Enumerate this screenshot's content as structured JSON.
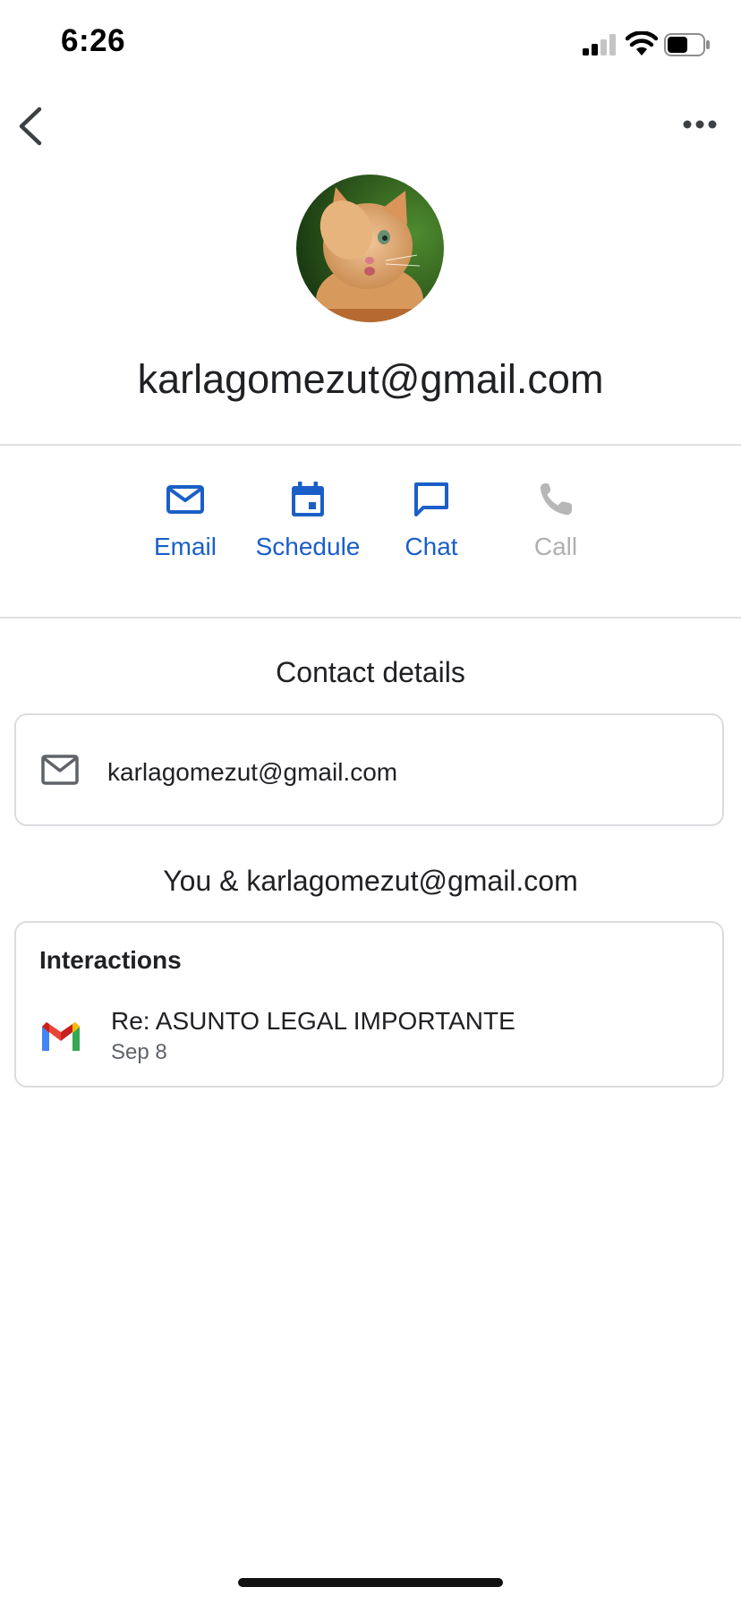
{
  "status_bar": {
    "time": "6:26"
  },
  "contact": {
    "name": "karlagomezut@gmail.com"
  },
  "actions": [
    {
      "label": "Email",
      "icon": "mail-icon",
      "enabled": true
    },
    {
      "label": "Schedule",
      "icon": "calendar-icon",
      "enabled": true
    },
    {
      "label": "Chat",
      "icon": "chat-icon",
      "enabled": true
    },
    {
      "label": "Call",
      "icon": "phone-icon",
      "enabled": false
    }
  ],
  "contact_details": {
    "title": "Contact details",
    "email": "karlagomezut@gmail.com"
  },
  "shared": {
    "title": "You & karlagomezut@gmail.com",
    "interactions_heading": "Interactions",
    "items": [
      {
        "subject": "Re: ASUNTO LEGAL IMPORTANTE",
        "date": "Sep 8",
        "icon": "gmail-icon"
      }
    ]
  },
  "colors": {
    "accent": "#1a5fc7",
    "disabled": "#b0b0b0",
    "divider": "#e0e0e0"
  }
}
